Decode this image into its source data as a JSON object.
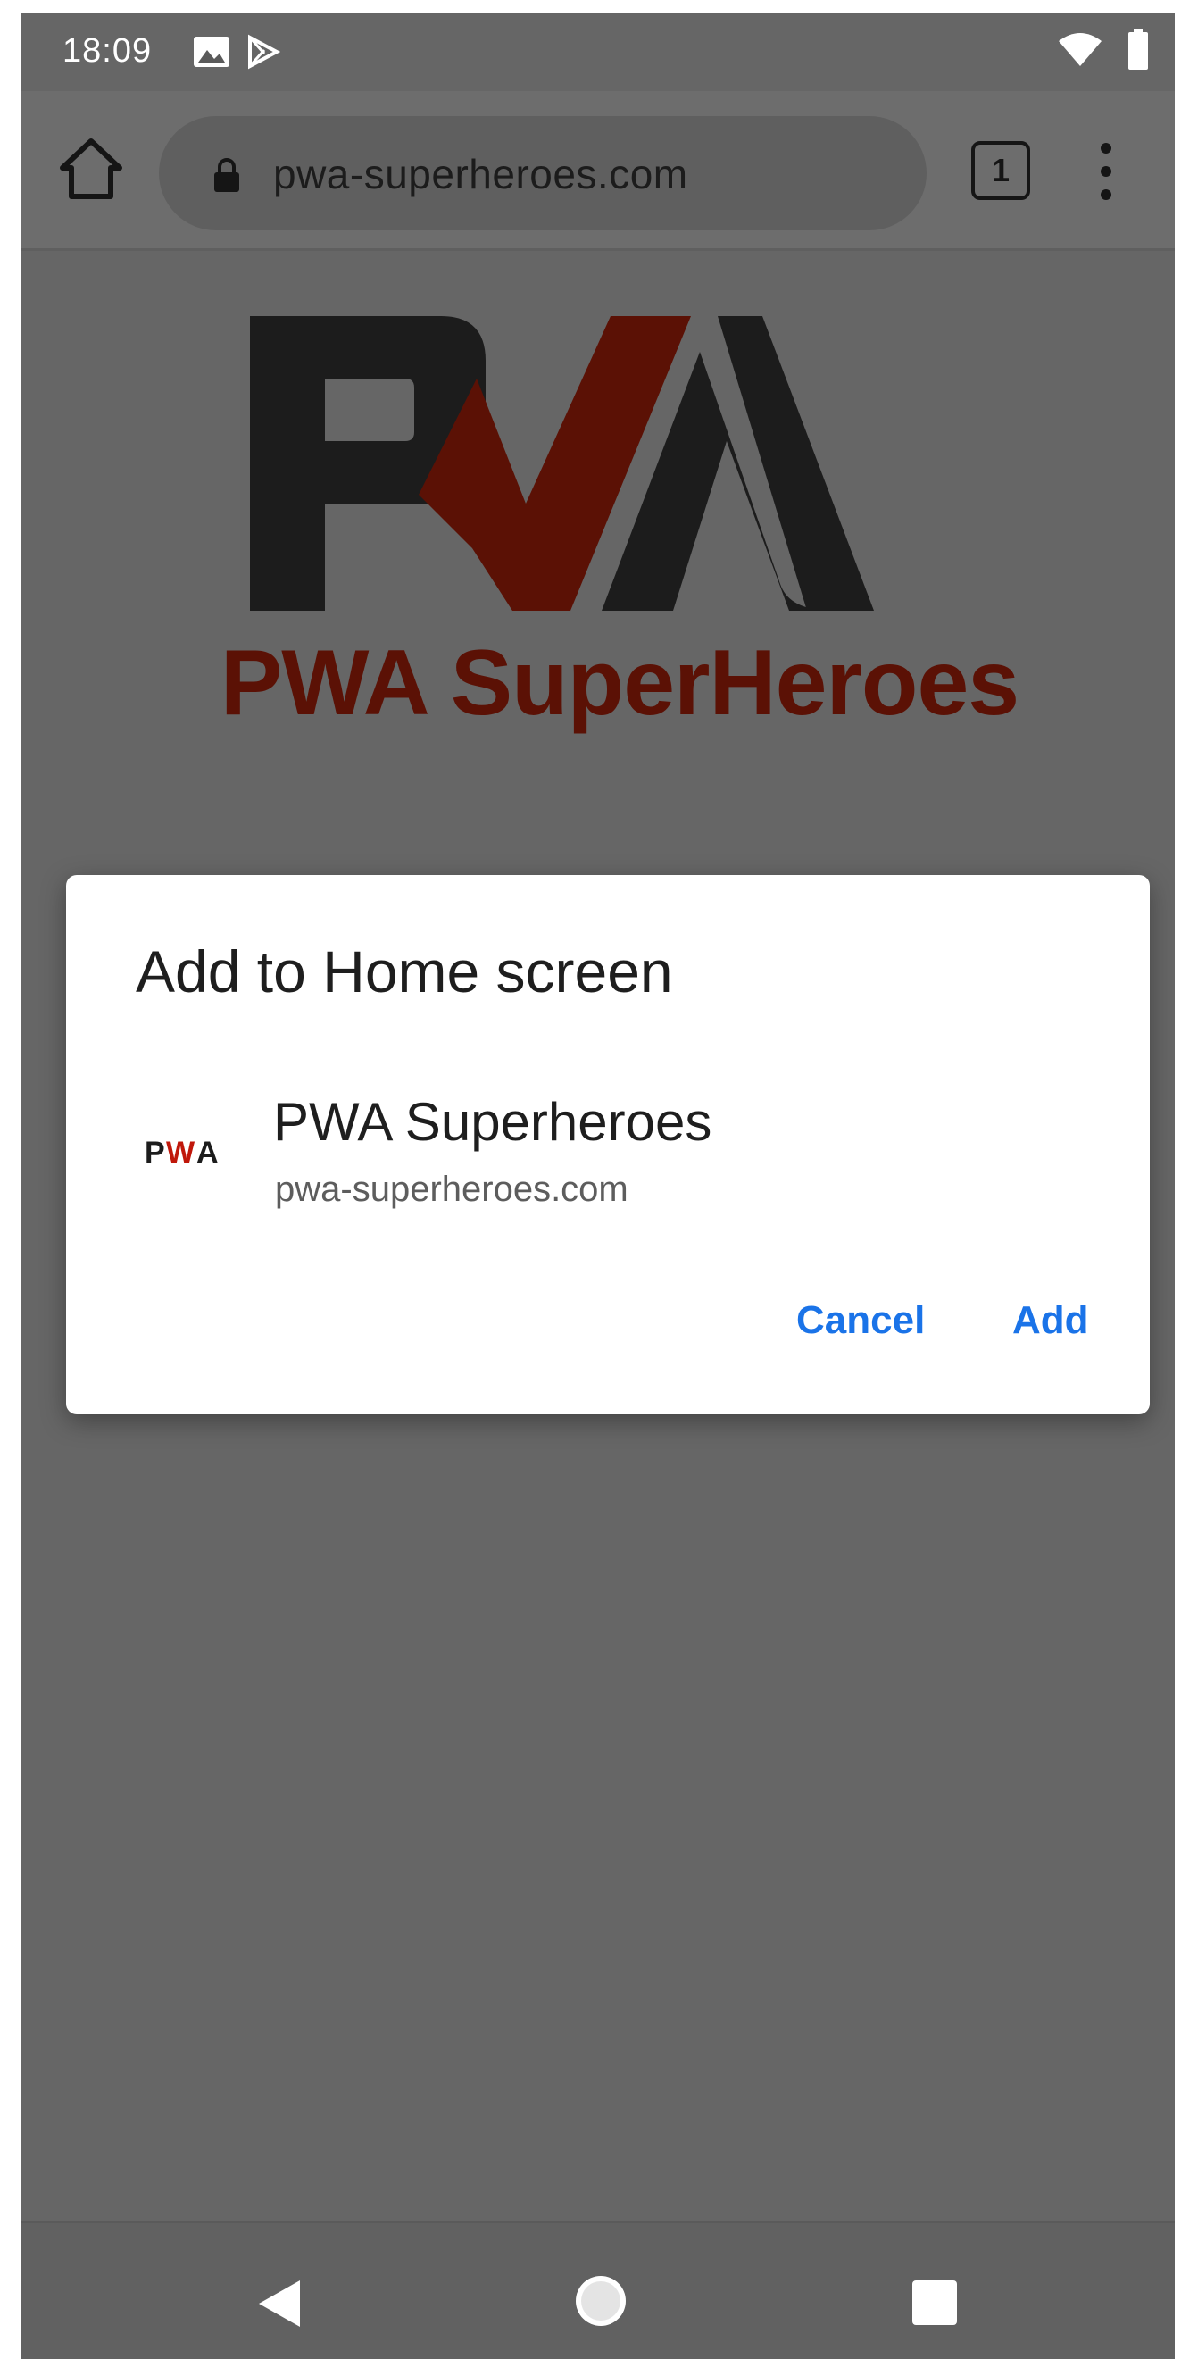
{
  "status_bar": {
    "time": "18:09",
    "icons": [
      "image-icon",
      "play-store-icon",
      "wifi-icon",
      "battery-icon"
    ]
  },
  "browser": {
    "url": "pwa-superheroes.com",
    "tab_count": "1",
    "icons": [
      "home-icon",
      "lock-icon",
      "tabs-icon",
      "menu-icon"
    ]
  },
  "page": {
    "logo_text": "PWA",
    "brand_title": "PWA SuperHeroes",
    "colors": {
      "logo_dark": "#1c1c1c",
      "logo_red": "#5b1105"
    }
  },
  "dialog": {
    "title": "Add to Home screen",
    "app_icon_text": "PWA",
    "app_name": "PWA Superheroes",
    "app_url": "pwa-superheroes.com",
    "cancel_label": "Cancel",
    "add_label": "Add",
    "colors": {
      "button": "#1a73e8"
    }
  },
  "nav_bar": {
    "icons": [
      "back-icon",
      "home-icon",
      "recents-icon"
    ]
  }
}
